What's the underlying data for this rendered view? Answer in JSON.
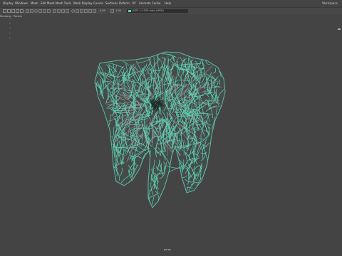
{
  "menubar": {
    "items": [
      "Display",
      "Windows",
      "Mesh",
      "Edit Mesh",
      "Mesh Tools",
      "Mesh Display",
      "Curves",
      "Surfaces",
      "Deform",
      "UV",
      "Animate",
      "Cache",
      "Help"
    ],
    "workspace": "Workspace"
  },
  "statusline": {
    "frame_value": "0.00",
    "scale_value": "1.00",
    "colorspace_text": "ACES 1.0 SDR-video (sRGB)"
  },
  "panelmenu": {
    "items": [
      "Renderer",
      "Panels"
    ]
  },
  "viewport": {
    "camera": "persp",
    "model": "tooth-wireframe",
    "wire_color": "#5fd2b6",
    "inner_color": "#9aa39f",
    "background": "#444444"
  }
}
